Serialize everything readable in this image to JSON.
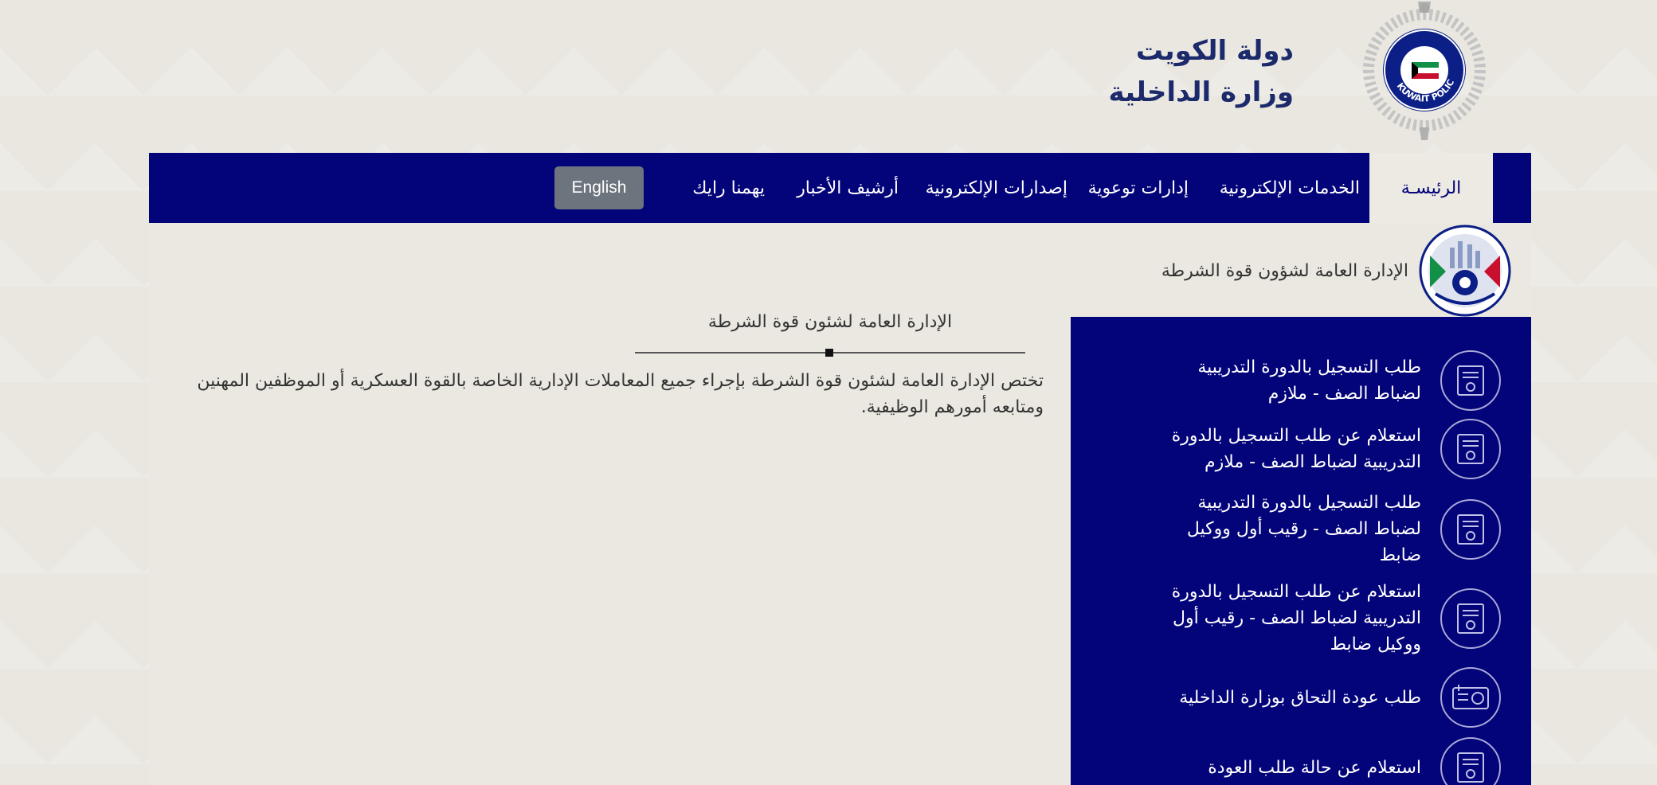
{
  "header": {
    "state_name": "دولة الكويت",
    "ministry_name": "وزارة الداخلية",
    "logo_text": "KUWAIT POLICE"
  },
  "nav": {
    "home": "الرئيسـة",
    "items": [
      "الخدمات الإلكترونية",
      "إدارات توعوية",
      "إصدارات الإلكترونية",
      "أرشيف الأخبار",
      "يهمنا رايك"
    ],
    "english_label": "English"
  },
  "department": {
    "title": "الإدارة العامة لشؤون قوة الشرطة"
  },
  "main": {
    "title": "الإدارة العامة لشئون قوة الشرطة",
    "description": "تختص الإدارة العامة لشئون قوة الشرطة بإجراء جميع المعاملات الإدارية الخاصة بالقوة العسكرية أو الموظفين المهنين ومتابعه أمورهم الوظيفية."
  },
  "services": [
    {
      "label": "طلب التسجيل بالدورة التدريبية لضباط الصف - ملازم",
      "icon": "certificate-icon"
    },
    {
      "label": "استعلام عن طلب التسجيل بالدورة التدريبية لضباط الصف - ملازم",
      "icon": "certificate-icon"
    },
    {
      "label": "طلب التسجيل بالدورة التدريبية لضباط الصف - رقيب أول ووكيل ضابط",
      "icon": "certificate-icon"
    },
    {
      "label": "استعلام عن طلب التسجيل بالدورة التدريبية لضباط الصف - رقيب أول ووكيل ضابط",
      "icon": "certificate-icon"
    },
    {
      "label": "طلب عودة التحاق بوزارة الداخلية",
      "icon": "id-card-icon"
    },
    {
      "label": "استعلام عن حالة طلب العودة",
      "icon": "certificate-icon"
    }
  ],
  "colors": {
    "nav_bg": "#03037a",
    "page_bg": "#e9e7e0",
    "header_text": "#1c2a6b",
    "english_btn": "#6c757d"
  }
}
